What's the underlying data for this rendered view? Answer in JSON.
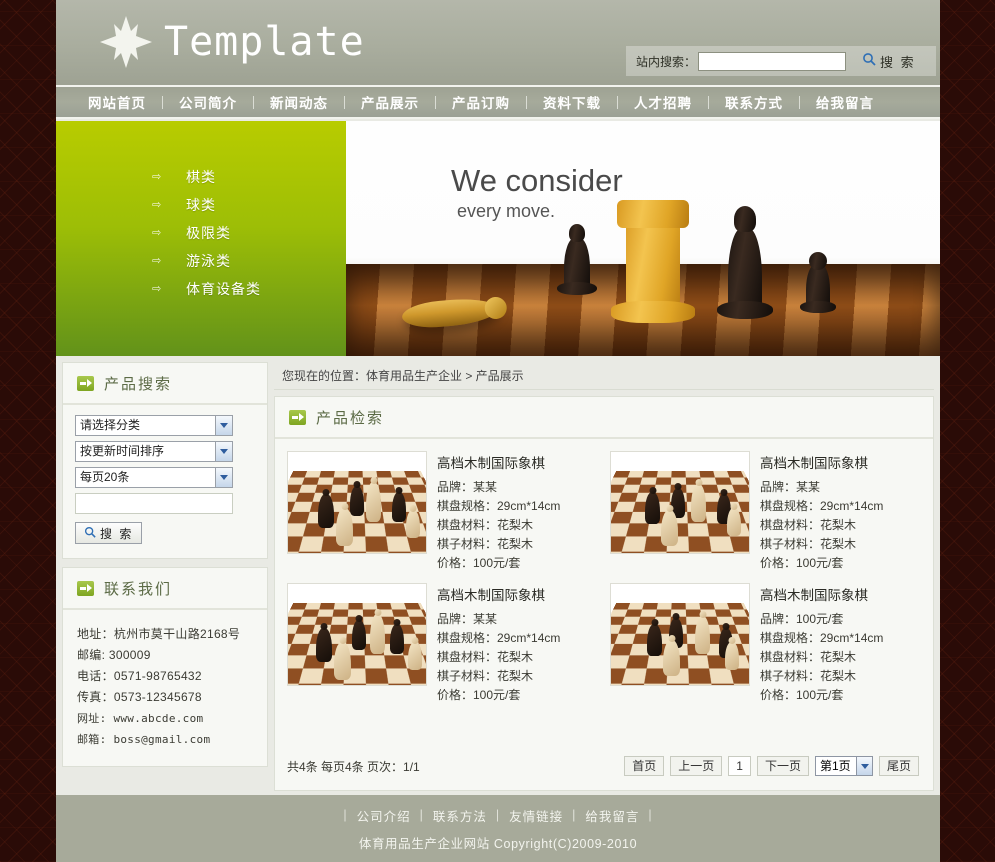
{
  "header": {
    "logo_text": "Template",
    "logo_icon": "diamond-burst-logo",
    "search": {
      "label": "站内搜索：",
      "value": "",
      "placeholder": "",
      "button_label": "搜 索",
      "button_icon": "search-icon"
    }
  },
  "nav": {
    "items": [
      {
        "label": "网站首页"
      },
      {
        "label": "公司简介"
      },
      {
        "label": "新闻动态"
      },
      {
        "label": "产品展示"
      },
      {
        "label": "产品订购"
      },
      {
        "label": "资料下载"
      },
      {
        "label": "人才招聘"
      },
      {
        "label": "联系方式"
      },
      {
        "label": "给我留言"
      }
    ]
  },
  "banner": {
    "categories": [
      {
        "label": "棋类"
      },
      {
        "label": "球类"
      },
      {
        "label": "极限类"
      },
      {
        "label": "游泳类"
      },
      {
        "label": "体育设备类"
      }
    ],
    "caption_line1": "We consider",
    "caption_line2": "every move.",
    "image_alt": "chess-pieces-photo"
  },
  "sidebar": {
    "product_search": {
      "title": "产品搜索",
      "icon": "green-arrow-icon",
      "category_select": "请选择分类",
      "sort_select": "按更新时间排序",
      "perpage_select": "每页20条",
      "keyword_value": "",
      "keyword_placeholder": "",
      "button_label": "搜 索",
      "button_icon": "search-icon"
    },
    "contact": {
      "title": "联系我们",
      "icon": "green-arrow-icon",
      "lines": [
        {
          "text": "地址：杭州市莫干山路2168号",
          "mono": false
        },
        {
          "text": "邮编: 300009",
          "mono": false
        },
        {
          "text": "电话：0571-98765432",
          "mono": false
        },
        {
          "text": "传真：0573-12345678",
          "mono": false
        },
        {
          "text": "网址: www.abcde.com",
          "mono": true
        },
        {
          "text": "邮箱: boss@gmail.com",
          "mono": true
        }
      ]
    }
  },
  "main": {
    "breadcrumb": "您现在的位置：体育用品生产企业  > 产品展示",
    "section_title": "产品检索",
    "section_icon": "green-arrow-icon",
    "products": [
      {
        "title": "高档木制国际象棋",
        "attrs": [
          "品牌：某某",
          "棋盘规格：29cm*14cm",
          "棋盘材料：花梨木",
          "棋子材料：花梨木",
          "价格：100元/套"
        ]
      },
      {
        "title": "高档木制国际象棋",
        "attrs": [
          "品牌：某某",
          "棋盘规格：29cm*14cm",
          "棋盘材料：花梨木",
          "棋子材料：花梨木",
          "价格：100元/套"
        ]
      },
      {
        "title": "高档木制国际象棋",
        "attrs": [
          "品牌：某某",
          "棋盘规格：29cm*14cm",
          "棋盘材料：花梨木",
          "棋子材料：花梨木",
          "价格：100元/套"
        ]
      },
      {
        "title": "高档木制国际象棋",
        "attrs": [
          "品牌：100元/套",
          "棋盘规格：29cm*14cm",
          "棋盘材料：花梨木",
          "棋子材料：花梨木",
          "价格：100元/套"
        ]
      }
    ],
    "pager": {
      "info": "共4条 每页4条 页次：1/1",
      "first": "首页",
      "prev": "上一页",
      "current_num": "1",
      "next": "下一页",
      "page_select": "第1页",
      "last": "尾页"
    }
  },
  "footer": {
    "links": [
      {
        "label": "公司介绍"
      },
      {
        "label": "联系方法"
      },
      {
        "label": "友情链接"
      },
      {
        "label": "给我留言"
      }
    ],
    "copyright": "体育用品生产企业网站  Copyright(C)2009-2010"
  },
  "colors": {
    "page_bg": "#2a0b07",
    "header_bg": "#a9ad9e",
    "nav_bg": "#9ea293",
    "accent_green": "#9dbe06",
    "panel_bg": "#f7f8f4",
    "footer_bg": "#a7aa9a",
    "title_green": "#5c6b46"
  }
}
